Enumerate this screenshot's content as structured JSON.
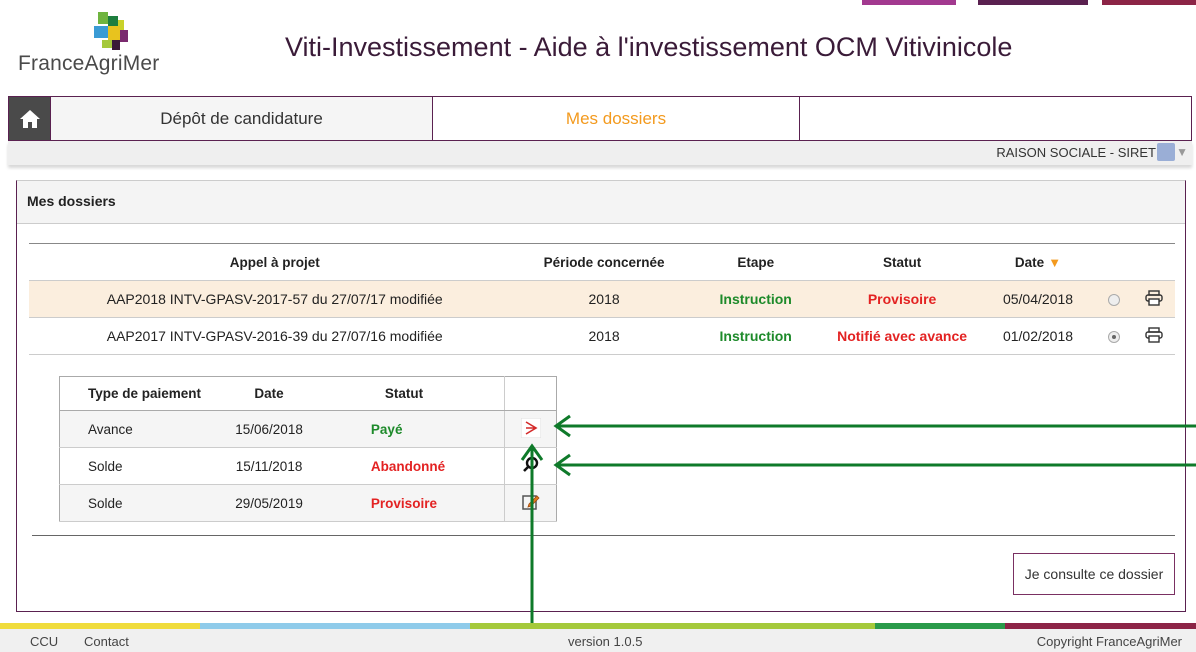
{
  "header": {
    "logo_text": "FranceAgriMer",
    "title": "Viti-Investissement - Aide à l'investissement OCM Vitivinicole"
  },
  "nav": {
    "items": [
      {
        "label": "Dépôt de candidature"
      },
      {
        "label": "Mes dossiers"
      }
    ]
  },
  "user": {
    "label": "RAISON SOCIALE - SIRET"
  },
  "panel": {
    "title": "Mes dossiers",
    "columns": [
      "Appel à projet",
      "Période concernée",
      "Etape",
      "Statut",
      "Date"
    ],
    "rows": [
      {
        "appel": "AAP2018 INTV-GPASV-2017-57 du 27/07/17 modifiée",
        "periode": "2018",
        "etape": "Instruction",
        "statut": "Provisoire",
        "date": "05/04/2018"
      },
      {
        "appel": "AAP2017 INTV-GPASV-2016-39 du 27/07/16 modifiée",
        "periode": "2018",
        "etape": "Instruction",
        "statut": "Notifié avec avance",
        "date": "01/02/2018"
      }
    ],
    "payments": {
      "columns": [
        "Type de paiement",
        "Date",
        "Statut"
      ],
      "rows": [
        {
          "type": "Avance",
          "date": "15/06/2018",
          "statut": "Payé"
        },
        {
          "type": "Solde",
          "date": "15/11/2018",
          "statut": "Abandonné"
        },
        {
          "type": "Solde",
          "date": "29/05/2019",
          "statut": "Provisoire"
        }
      ]
    },
    "consult_button": "Je consulte ce dossier"
  },
  "footer": {
    "ccu": "CCU",
    "contact": "Contact",
    "version": "version 1.0.5",
    "copyright": "Copyright FranceAgriMer"
  },
  "colors": {
    "brand_purple": "#5a2150",
    "accent_orange": "#f39a1e",
    "status_green": "#1d8a2a",
    "status_red": "#e32222",
    "annotation_green": "#0f7a2a"
  }
}
